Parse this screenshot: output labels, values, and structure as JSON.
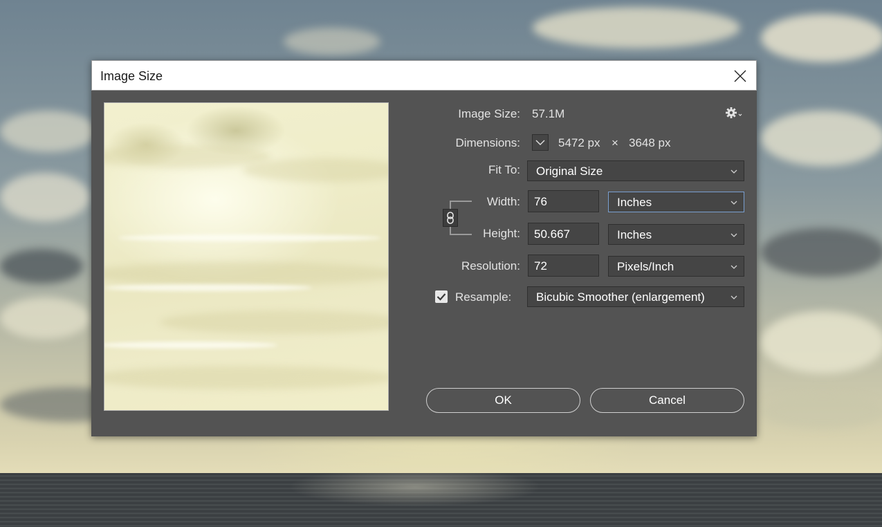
{
  "dialog": {
    "title": "Image Size",
    "close_icon": "close-icon"
  },
  "info": {
    "image_size_label": "Image Size:",
    "image_size_value": "57.1M",
    "settings_icon": "gear-icon",
    "dimensions_label": "Dimensions:",
    "dimensions_width": "5472 px",
    "dimensions_sep": "×",
    "dimensions_height": "3648 px"
  },
  "fit_to": {
    "label": "Fit To:",
    "value": "Original Size"
  },
  "width": {
    "label": "Width:",
    "value": "76",
    "unit": "Inches"
  },
  "height": {
    "label": "Height:",
    "value": "50.667",
    "unit": "Inches"
  },
  "resolution": {
    "label": "Resolution:",
    "value": "72",
    "unit": "Pixels/Inch"
  },
  "resample": {
    "label": "Resample:",
    "checked": true,
    "value": "Bicubic Smoother (enlargement)"
  },
  "buttons": {
    "ok": "OK",
    "cancel": "Cancel"
  },
  "colors": {
    "dialog_bg": "#535353",
    "field_bg": "#454545",
    "text": "#e2e2e2",
    "focus_border": "#7a9fd0"
  }
}
